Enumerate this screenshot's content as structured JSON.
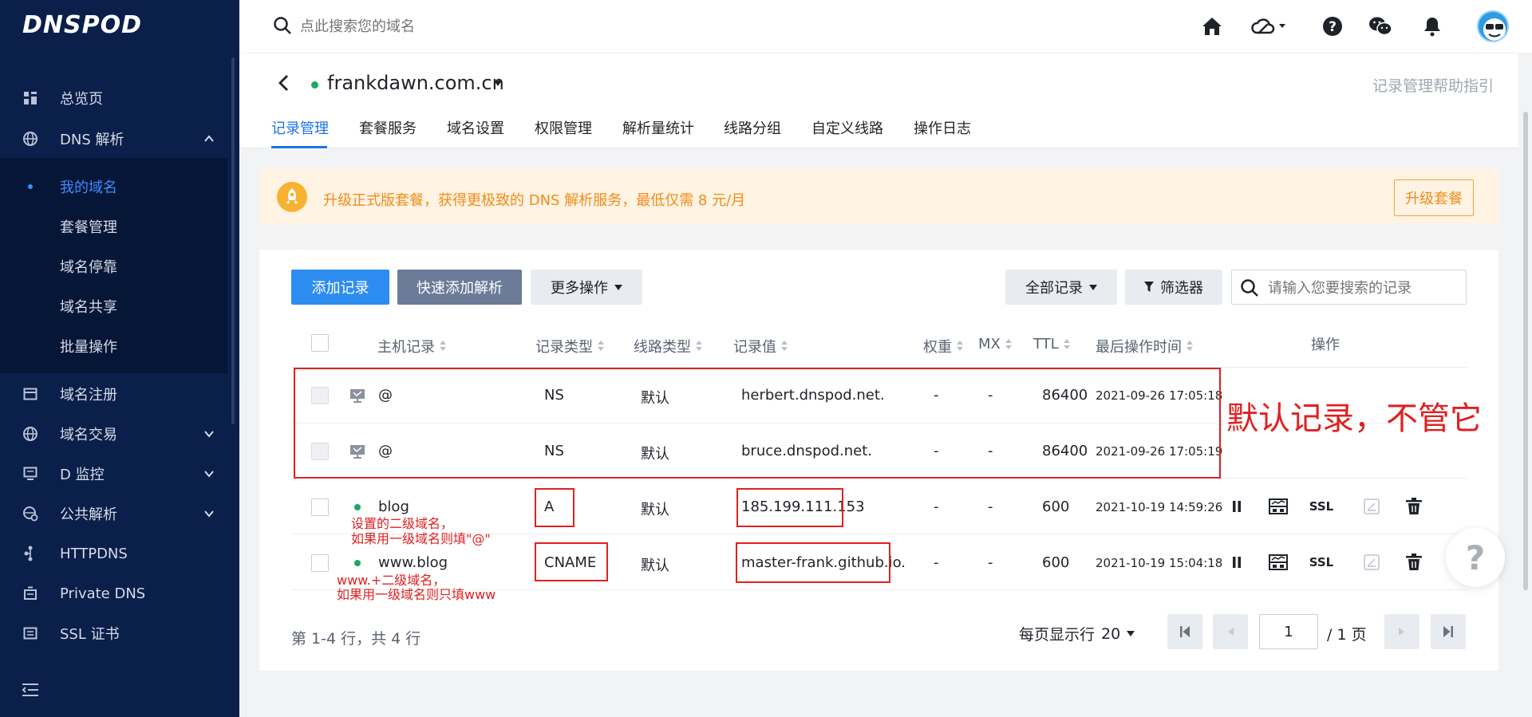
{
  "app": {
    "logo": "DNSPOD"
  },
  "sidebar": {
    "items": [
      {
        "label": "总览页",
        "icon": "dashboard-icon"
      },
      {
        "label": "DNS 解析",
        "icon": "globe-icon",
        "expanded": true
      },
      {
        "label": "域名注册",
        "icon": "calendar-icon"
      },
      {
        "label": "域名交易",
        "icon": "globe-icon"
      },
      {
        "label": "D 监控",
        "icon": "monitor-icon"
      },
      {
        "label": "公共解析",
        "icon": "public-globe-icon"
      },
      {
        "label": "HTTPDNS",
        "icon": "network-icon"
      },
      {
        "label": "Private DNS",
        "icon": "server-icon"
      },
      {
        "label": "SSL 证书",
        "icon": "certificate-icon"
      }
    ],
    "dns_sub_items": [
      {
        "label": "我的域名",
        "active": true
      },
      {
        "label": "套餐管理"
      },
      {
        "label": "域名停靠"
      },
      {
        "label": "域名共享"
      },
      {
        "label": "批量操作"
      }
    ]
  },
  "topbar": {
    "search_placeholder": "点此搜索您的域名",
    "icons": [
      "home-icon",
      "cloud-icon",
      "help-icon",
      "wechat-icon",
      "bell-icon"
    ]
  },
  "domain": {
    "name": "frankdawn.com.cn",
    "status_color": "#1aa864",
    "help_link": "记录管理帮助指引",
    "tabs": [
      "记录管理",
      "套餐服务",
      "域名设置",
      "权限管理",
      "解析量统计",
      "线路分组",
      "自定义线路",
      "操作日志"
    ]
  },
  "banner": {
    "text": "升级正式版套餐，获得更极致的 DNS 解析服务，最低仅需 8 元/月",
    "button": "升级套餐"
  },
  "toolbar": {
    "add_record": "添加记录",
    "quick_add": "快速添加解析",
    "more_actions": "更多操作",
    "all_records": "全部记录",
    "filter": "筛选器",
    "search_placeholder": "请输入您要搜索的记录"
  },
  "table": {
    "headers": {
      "host": "主机记录",
      "type": "记录类型",
      "line": "线路类型",
      "value": "记录值",
      "weight": "权重",
      "mx": "MX",
      "ttl": "TTL",
      "updated": "最后操作时间",
      "actions": "操作"
    },
    "rows": [
      {
        "host": "@",
        "type": "NS",
        "line": "默认",
        "value": "herbert.dnspod.net.",
        "weight": "-",
        "mx": "-",
        "ttl": "86400",
        "updated": "2021-09-26 17:05:18",
        "system": true
      },
      {
        "host": "@",
        "type": "NS",
        "line": "默认",
        "value": "bruce.dnspod.net.",
        "weight": "-",
        "mx": "-",
        "ttl": "86400",
        "updated": "2021-09-26 17:05:19",
        "system": true
      },
      {
        "host": "blog",
        "type": "A",
        "line": "默认",
        "value": "185.199.111.153",
        "weight": "-",
        "mx": "-",
        "ttl": "600",
        "updated": "2021-10-19 14:59:26",
        "system": false
      },
      {
        "host": "www.blog",
        "type": "CNAME",
        "line": "默认",
        "value": "master-frank.github.io.",
        "weight": "-",
        "mx": "-",
        "ttl": "600",
        "updated": "2021-10-19 15:04:18",
        "system": false
      }
    ],
    "action_ssl": "SSL"
  },
  "annotations": {
    "default_records": "默认记录，不管它",
    "second_level_line1": "设置的二级域名，",
    "second_level_line2": "如果用一级域名则填\"@\"",
    "www_line1": "www.+二级域名，",
    "www_line2": "如果用一级域名则只填www"
  },
  "pagination": {
    "summary": "第 1-4 行，共 4 行",
    "per_page_label": "每页显示行",
    "per_page": "20",
    "current_page": "1",
    "total_pages": "/ 1 页"
  },
  "colors": {
    "sidebar_bg": "#0b1f4b",
    "accent": "#2d8cf0",
    "annotation": "#e02020",
    "banner_bg": "#fff3e3",
    "banner_text": "#f08c1a"
  }
}
